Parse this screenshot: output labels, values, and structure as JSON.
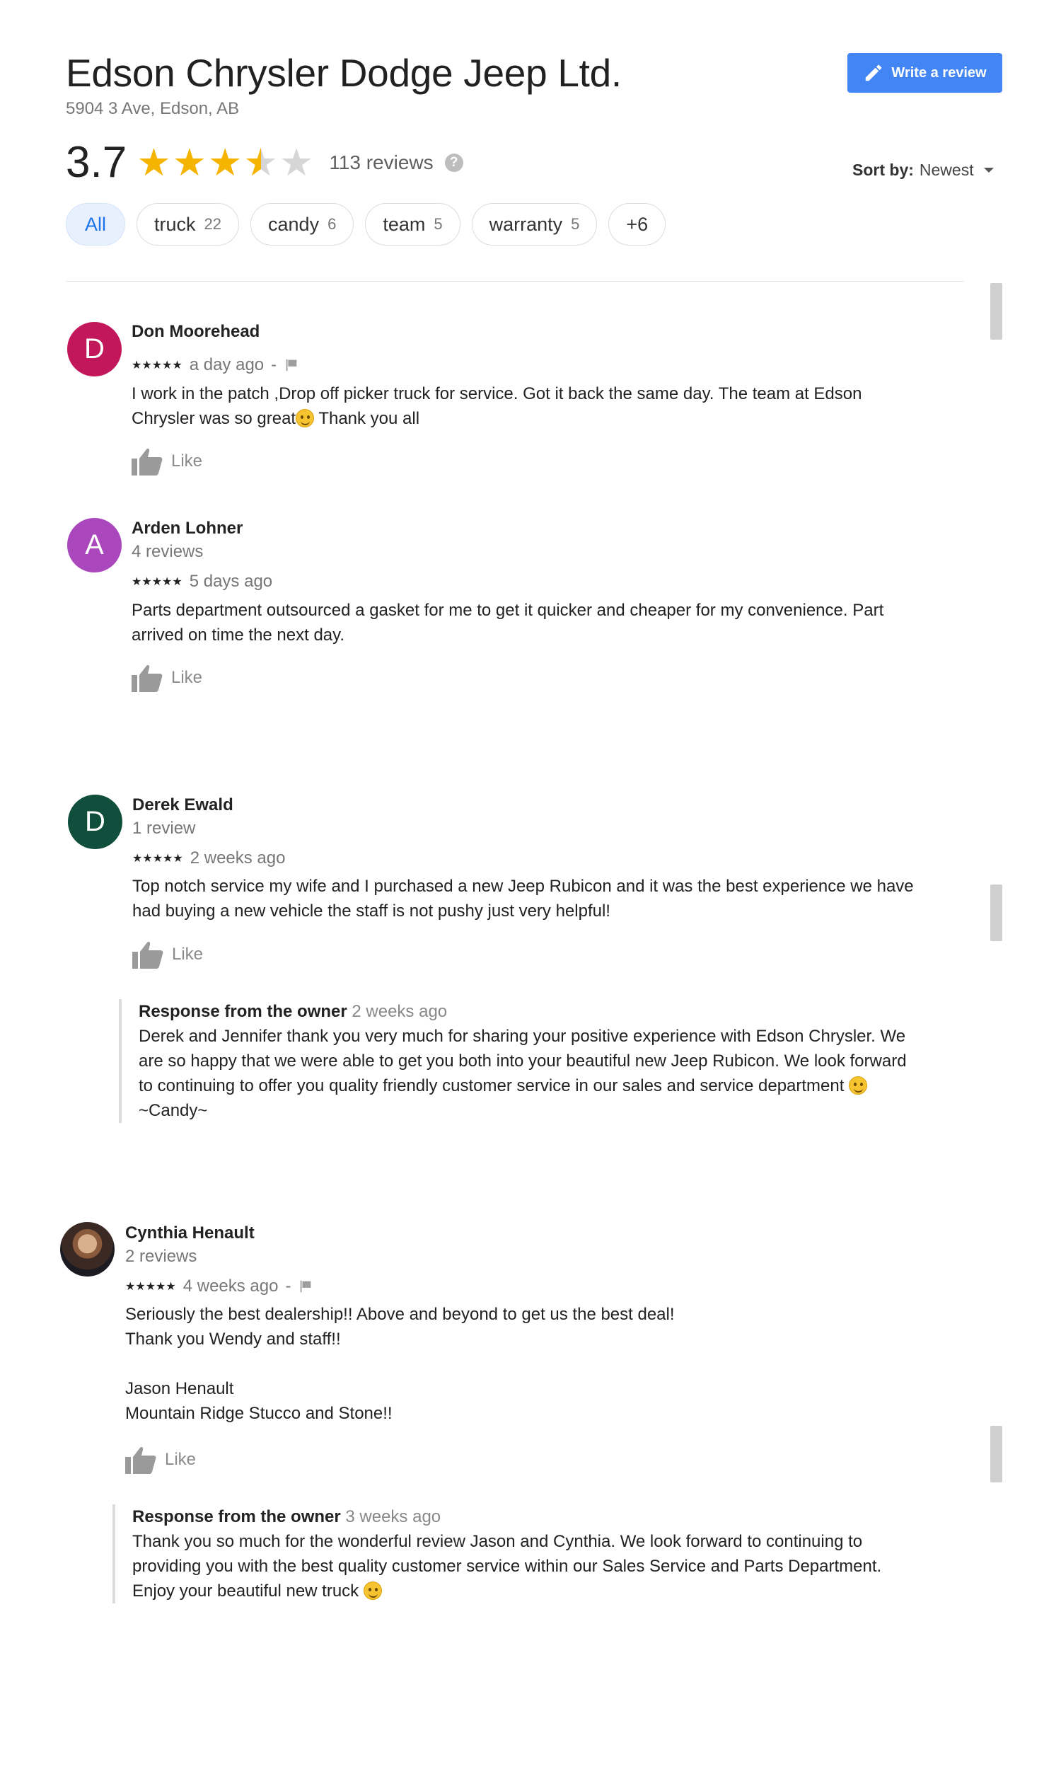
{
  "header": {
    "title": "Edson Chrysler Dodge Jeep Ltd.",
    "address": "5904 3 Ave, Edson, AB",
    "write_review_label": "Write a review",
    "rating": "3.7",
    "rating_value": 3.7,
    "review_count": "113 reviews",
    "sort_label": "Sort by:",
    "sort_value": "Newest"
  },
  "chips": [
    {
      "label": "All",
      "count": ""
    },
    {
      "label": "truck",
      "count": "22"
    },
    {
      "label": "candy",
      "count": "6"
    },
    {
      "label": "team",
      "count": "5"
    },
    {
      "label": "warranty",
      "count": "5"
    },
    {
      "label": "+6",
      "count": ""
    }
  ],
  "colors": {
    "accent": "#4285f4",
    "star": "#f5b400",
    "chip_active_bg": "#e8f0fe"
  },
  "reviews": [
    {
      "initial": "D",
      "avatar_color": "#c2185b",
      "name": "Don Moorehead",
      "sub": "",
      "stars": "★★★★★",
      "rating": 5,
      "time": "a day ago",
      "dash": "-",
      "text1": "I work in the patch ,Drop off picker truck for service. Got it back the same day. The team at Edson",
      "text2a": "Chrysler was so great",
      "text2b": " Thank you all",
      "like": "Like"
    },
    {
      "initial": "A",
      "avatar_color": "#ab47bc",
      "name": "Arden Lohner",
      "sub": "4 reviews",
      "stars": "★★★★★",
      "rating": 5,
      "time": "5 days ago",
      "text1": "Parts department outsourced a gasket for me to get it quicker and cheaper for my convenience. Part",
      "text2": "arrived on time the next day.",
      "like": "Like"
    },
    {
      "initial": "D",
      "avatar_color": "#0f4f3b",
      "name": "Derek Ewald",
      "sub": "1 review",
      "stars": "★★★★★",
      "rating": 5,
      "time": "2 weeks ago",
      "text1": "Top notch service my wife and I purchased a new Jeep Rubicon and it was the best experience we have",
      "text2": "had buying a new vehicle the staff is not pushy just very helpful!",
      "like": "Like",
      "response": {
        "label": "Response from the owner",
        "time": "2 weeks ago",
        "line1": "Derek and Jennifer thank you very much for sharing your positive experience with Edson Chrysler. We",
        "line2": "are so happy that we were able to get you both into your beautiful new Jeep Rubicon. We look forward",
        "line3": "to continuing to offer you quality friendly customer service in our sales and service department",
        "line4": "~Candy~"
      }
    },
    {
      "name": "Cynthia Henault",
      "sub": "2 reviews",
      "stars": "★★★★★",
      "rating": 5,
      "time": "4 weeks ago",
      "dash": "-",
      "text1": "Seriously the best dealership!! Above and beyond to get us the best deal!",
      "text2": "Thank you Wendy and staff!!",
      "text3": "Jason Henault",
      "text4": "Mountain Ridge Stucco and Stone!!",
      "like": "Like",
      "response": {
        "label": "Response from the owner",
        "time": "3 weeks ago",
        "line1": "Thank you so much for the wonderful review Jason and Cynthia. We look forward to continuing to",
        "line2": "providing you with the best quality customer service within our Sales Service and Parts Department.",
        "line3": "Enjoy your beautiful new truck"
      }
    }
  ]
}
